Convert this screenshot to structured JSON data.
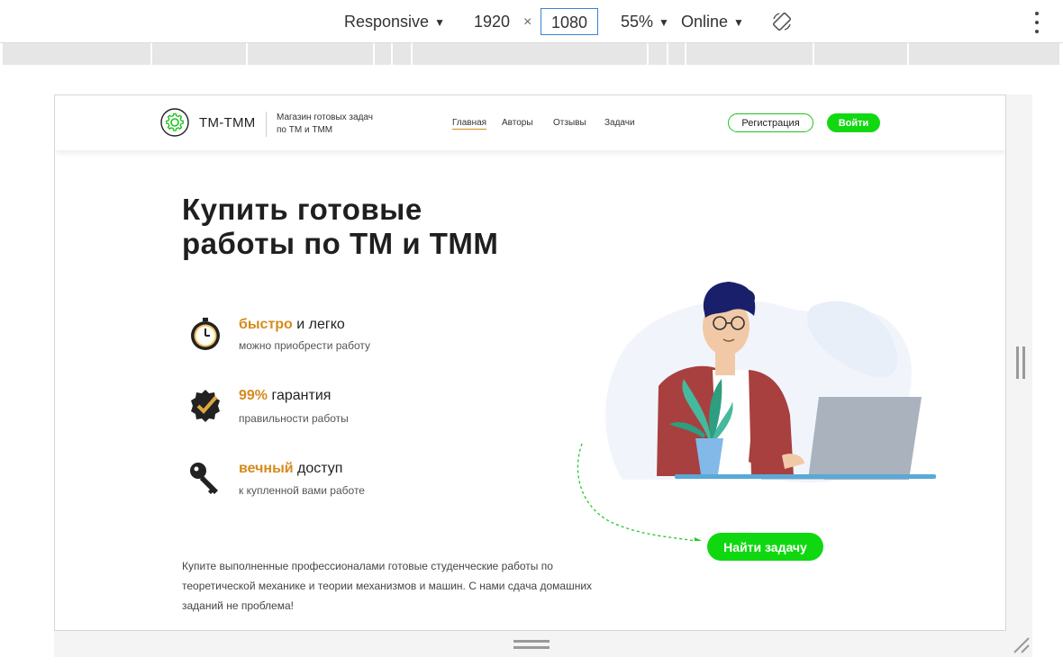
{
  "devtools": {
    "device": "Responsive",
    "width": "1920",
    "height": "1080",
    "times": "×",
    "zoom": "55%",
    "throttle": "Online",
    "rotate_icon": "rotate-icon",
    "menu_icon": "kebab-menu-icon"
  },
  "site": {
    "logo_text": "ТМ-ТММ",
    "tagline": "Магазин готовых задач по ТМ и ТММ",
    "nav": [
      {
        "label": "Главная",
        "active": true
      },
      {
        "label": "Авторы",
        "active": false
      },
      {
        "label": "Отзывы",
        "active": false
      },
      {
        "label": "Задачи",
        "active": false
      }
    ],
    "register_label": "Регистрация",
    "login_label": "Войти",
    "hero": {
      "title_line1": "Купить готовые",
      "title_line2": "работы по ТМ и ТММ",
      "description": "Купите выполненные профессионалами готовые студенческие работы по теоретической механике и теории механизмов и машин. С нами сдача домашних заданий не проблема!",
      "cta_label": "Найти задачу"
    },
    "features": [
      {
        "icon": "stopwatch-icon",
        "highlight": "быстро",
        "rest": " и легко",
        "subtitle": "можно приобрести работу"
      },
      {
        "icon": "badge-check-icon",
        "highlight": "99%",
        "rest": " гарантия",
        "subtitle": "правильности работы"
      },
      {
        "icon": "key-icon",
        "highlight": "вечный",
        "rest": " доступ",
        "subtitle": "к купленной вами работе"
      }
    ]
  },
  "colors": {
    "accent_green": "#12d812",
    "accent_orange": "#d68a1e",
    "focus_blue": "#3b82d4"
  }
}
